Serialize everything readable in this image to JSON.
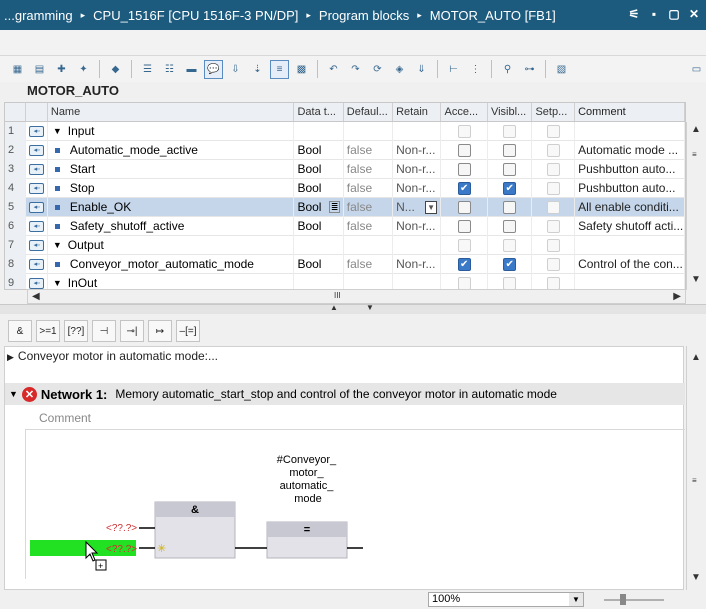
{
  "titlebar": {
    "crumbs": [
      "...gramming",
      "CPU_1516F [CPU 1516F-3 PN/DP]",
      "Program blocks",
      "MOTOR_AUTO [FB1]"
    ],
    "sep": "▸",
    "controls": [
      "⚟",
      "▪",
      "▢",
      "✕"
    ]
  },
  "block": {
    "title": "MOTOR_AUTO"
  },
  "columns": [
    "Name",
    "Data t...",
    "Defaul...",
    "Retain",
    "Acce...",
    "Visibl...",
    "Setp...",
    "Comment"
  ],
  "rows": [
    {
      "num": "1",
      "section": true,
      "name": "Input"
    },
    {
      "num": "2",
      "name": "Automatic_mode_active",
      "type": "Bool",
      "default": "false",
      "retain": "Non-r...",
      "access": false,
      "visible": false,
      "comment": "Automatic mode ..."
    },
    {
      "num": "3",
      "name": "Start",
      "type": "Bool",
      "default": "false",
      "retain": "Non-r...",
      "access": false,
      "visible": false,
      "comment": "Pushbutton auto..."
    },
    {
      "num": "4",
      "name": "Stop",
      "type": "Bool",
      "default": "false",
      "retain": "Non-r...",
      "access": true,
      "visible": true,
      "comment": "Pushbutton auto..."
    },
    {
      "num": "5",
      "name": "Enable_OK",
      "type": "Bool",
      "default": "false",
      "retain": "N...",
      "access": false,
      "visible": false,
      "comment": "All enable conditi...",
      "selected": true
    },
    {
      "num": "6",
      "name": "Safety_shutoff_active",
      "type": "Bool",
      "default": "false",
      "retain": "Non-r...",
      "access": false,
      "visible": false,
      "comment": "Safety shutoff acti..."
    },
    {
      "num": "7",
      "section": true,
      "name": "Output"
    },
    {
      "num": "8",
      "name": "Conveyor_motor_automatic_mode",
      "type": "Bool",
      "default": "false",
      "retain": "Non-r...",
      "access": true,
      "visible": true,
      "comment": "Control of the con..."
    },
    {
      "num": "9",
      "section": true,
      "name": "InOut"
    }
  ],
  "ladder_toolbar": [
    "&",
    ">=1",
    "[??]",
    "⊣",
    "⊸|",
    "↦",
    "–[=]"
  ],
  "editor": {
    "block_comment": "Conveyor motor in automatic mode:...",
    "network_label": "Network 1:",
    "network_title": "Memory automatic_start_stop and control of the conveyor motor in automatic mode",
    "comment_placeholder": "Comment",
    "coil_label": "#Conveyor_\nmotor_\nautomatic_\nmode",
    "and_label": "&",
    "coil_symbol": "=",
    "operand_placeholder": "<??.?>",
    "operand_placeholder_2": "<??.?>"
  },
  "hscroll_label": "III",
  "status": {
    "zoom": "100%"
  },
  "colors": {
    "title_bar": "#1c5b7e",
    "selection": "#c6d6ea",
    "highlight": "#22e022",
    "error": "#d72929"
  }
}
